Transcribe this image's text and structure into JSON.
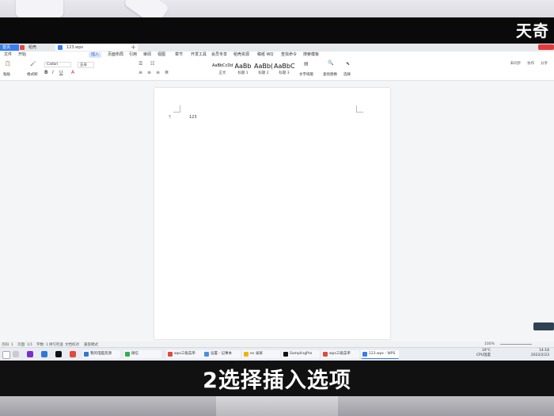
{
  "watermark": {
    "logo": "天奇"
  },
  "caption": "2选择插入选项",
  "tabs": {
    "home": "首页",
    "dh": "稻壳",
    "doc": "123.wps",
    "add": "+"
  },
  "menu": [
    "文件",
    "开始",
    "插入",
    "页面布局",
    "引用",
    "审阅",
    "视图",
    "章节",
    "开发工具",
    "会员专享",
    "稻壳资源",
    "稿纸 WQ",
    "查找命令",
    "搜索模板"
  ],
  "menu_active": "插入",
  "ribbon": {
    "paste": "粘贴",
    "format_painter": "格式刷",
    "font": "Calibri",
    "size": "五号",
    "styles": [
      {
        "big": "AaBbCcDd",
        "lbl": "正文"
      },
      {
        "big": "AaBb",
        "lbl": "标题 1"
      },
      {
        "big": "AaBb(",
        "lbl": "标题 2"
      },
      {
        "big": "AaBbC",
        "lbl": "标题 3"
      }
    ],
    "text_tools": "文字排版",
    "find_replace": "查找替换",
    "select": "选择"
  },
  "right_tools": {
    "cloud": "未同步",
    "collab": "协作",
    "share": "分享"
  },
  "document": {
    "number": "123"
  },
  "statusbar": {
    "page": "页码: 1",
    "pages": "页面: 1/1",
    "words": "字数: 1",
    "spell": "拼写检查",
    "doc_check": "文档校对",
    "compat": "兼容模式",
    "zoom": "100%"
  },
  "taskbar": {
    "apps": [
      "我的电脑资源",
      "微信",
      "wps三级菜单",
      "设置 - 记事本",
      "ev 录屏",
      "SamplingPro",
      "wps三级菜单",
      "123.wps - WPS"
    ],
    "weather": "19°C",
    "weather_desc": "CPU温度",
    "time": "14:18",
    "date": "2022/2/23"
  }
}
